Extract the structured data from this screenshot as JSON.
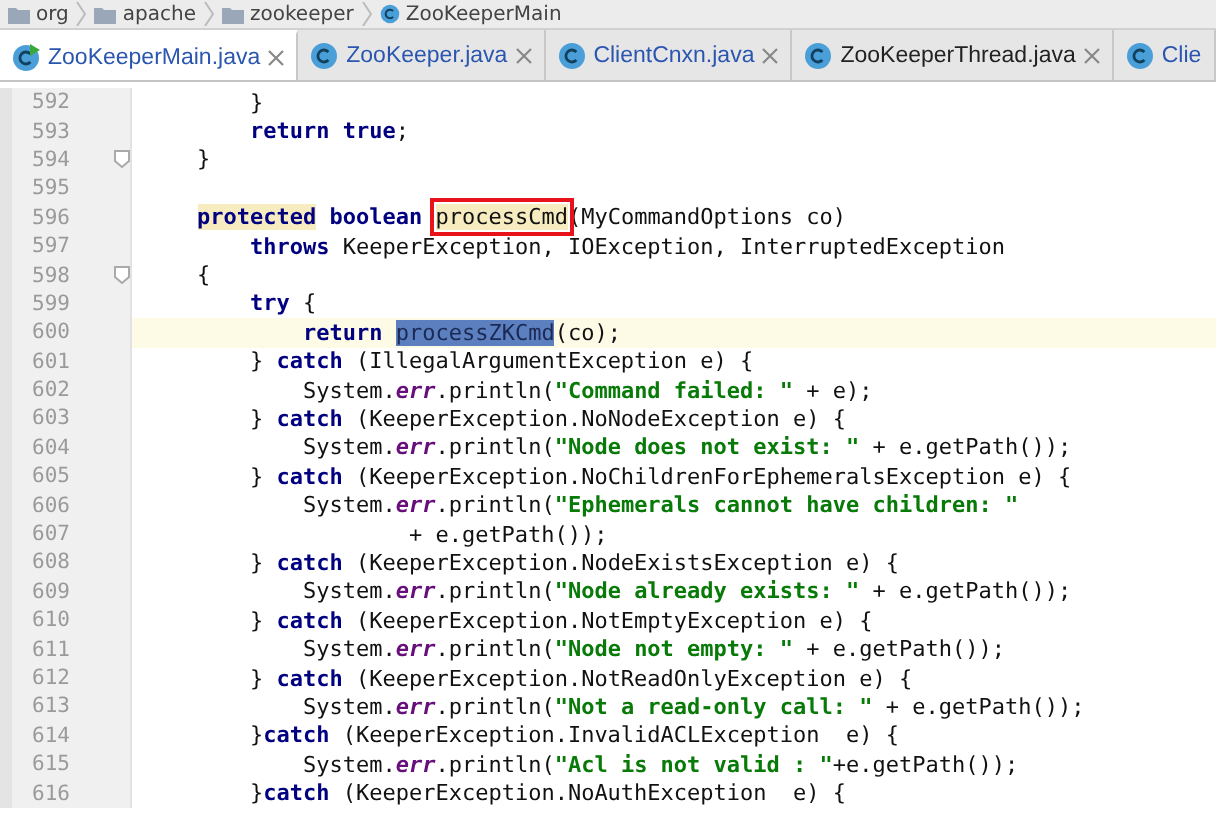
{
  "breadcrumbs": [
    {
      "label": "org",
      "kind": "folder"
    },
    {
      "label": "apache",
      "kind": "folder"
    },
    {
      "label": "zookeeper",
      "kind": "folder"
    },
    {
      "label": "ZooKeeperMain",
      "kind": "class"
    }
  ],
  "tabs": [
    {
      "label": "ZooKeeperMain.java",
      "selected": true,
      "runnable": true,
      "closable": true,
      "color": "#2a56b0"
    },
    {
      "label": "ZooKeeper.java",
      "selected": false,
      "runnable": false,
      "closable": true,
      "color": "#2a56b0"
    },
    {
      "label": "ClientCnxn.java",
      "selected": false,
      "runnable": false,
      "closable": true,
      "color": "#2a56b0"
    },
    {
      "label": "ZooKeeperThread.java",
      "selected": false,
      "runnable": false,
      "closable": true,
      "color": "#222222"
    },
    {
      "label": "Clie",
      "selected": false,
      "runnable": false,
      "closable": false,
      "color": "#2a56b0"
    }
  ],
  "lines": [
    {
      "number": "592",
      "current": false,
      "fold": false,
      "tokens": [
        {
          "text": "        }",
          "kind": "plain"
        }
      ]
    },
    {
      "number": "593",
      "current": false,
      "fold": false,
      "tokens": [
        {
          "text": "        return",
          "kind": "keyword"
        },
        {
          "text": " true",
          "kind": "keyword"
        },
        {
          "text": ";",
          "kind": "plain"
        }
      ]
    },
    {
      "number": "594",
      "current": false,
      "fold": true,
      "tokens": [
        {
          "text": "    }",
          "kind": "plain"
        }
      ]
    },
    {
      "number": "595",
      "current": false,
      "fold": false
    },
    {
      "number": "596",
      "current": false,
      "fold": false,
      "tokens": [
        {
          "text": "    protected",
          "kind": "warning"
        },
        {
          "text": " boolean ",
          "kind": "keyword"
        },
        {
          "text": "processCmd",
          "kind": "boxed"
        },
        {
          "text": "(MyCommandOptions co)",
          "kind": "plain"
        }
      ]
    },
    {
      "number": "597",
      "current": false,
      "fold": false,
      "tokens": [
        {
          "text": "        throws",
          "kind": "keyword"
        },
        {
          "text": " KeeperException, IOException, InterruptedException",
          "kind": "plain"
        }
      ]
    },
    {
      "number": "598",
      "current": false,
      "fold": true,
      "tokens": [
        {
          "text": "    {",
          "kind": "plain"
        }
      ]
    },
    {
      "number": "599",
      "current": false,
      "fold": false,
      "tokens": [
        {
          "text": "        try",
          "kind": "keyword"
        },
        {
          "text": " {",
          "kind": "plain"
        }
      ]
    },
    {
      "number": "600",
      "current": true,
      "fold": false,
      "tokens": [
        {
          "text": "            return ",
          "kind": "keyword"
        },
        {
          "text": "processZKCmd",
          "kind": "selected"
        },
        {
          "text": "(co);",
          "kind": "plain"
        }
      ]
    },
    {
      "number": "601",
      "current": false,
      "fold": false,
      "tokens": [
        {
          "text": "        } ",
          "kind": "plain"
        },
        {
          "text": "catch",
          "kind": "keyword"
        },
        {
          "text": " (IllegalArgumentException e) {",
          "kind": "plain"
        }
      ]
    },
    {
      "number": "602",
      "current": false,
      "fold": false,
      "tokens": [
        {
          "text": "            System.",
          "kind": "plain"
        },
        {
          "text": "err",
          "kind": "field"
        },
        {
          "text": ".println(",
          "kind": "plain"
        },
        {
          "text": "\"Command failed: \"",
          "kind": "string"
        },
        {
          "text": " + e);",
          "kind": "plain"
        }
      ]
    },
    {
      "number": "603",
      "current": false,
      "fold": false,
      "tokens": [
        {
          "text": "        } ",
          "kind": "plain"
        },
        {
          "text": "catch",
          "kind": "keyword"
        },
        {
          "text": " (KeeperException.NoNodeException e) {",
          "kind": "plain"
        }
      ]
    },
    {
      "number": "604",
      "current": false,
      "fold": false,
      "tokens": [
        {
          "text": "            System.",
          "kind": "plain"
        },
        {
          "text": "err",
          "kind": "field"
        },
        {
          "text": ".println(",
          "kind": "plain"
        },
        {
          "text": "\"Node does not exist: \"",
          "kind": "string"
        },
        {
          "text": " + e.getPath());",
          "kind": "plain"
        }
      ]
    },
    {
      "number": "605",
      "current": false,
      "fold": false,
      "tokens": [
        {
          "text": "        } ",
          "kind": "plain"
        },
        {
          "text": "catch",
          "kind": "keyword"
        },
        {
          "text": " (KeeperException.NoChildrenForEphemeralsException e) {",
          "kind": "plain"
        }
      ]
    },
    {
      "number": "606",
      "current": false,
      "fold": false,
      "tokens": [
        {
          "text": "            System.",
          "kind": "plain"
        },
        {
          "text": "err",
          "kind": "field"
        },
        {
          "text": ".println(",
          "kind": "plain"
        },
        {
          "text": "\"Ephemerals cannot have children: \"",
          "kind": "string"
        }
      ]
    },
    {
      "number": "607",
      "current": false,
      "fold": false,
      "tokens": [
        {
          "text": "                    + e.getPath());",
          "kind": "plain"
        }
      ]
    },
    {
      "number": "608",
      "current": false,
      "fold": false,
      "tokens": [
        {
          "text": "        } ",
          "kind": "plain"
        },
        {
          "text": "catch",
          "kind": "keyword"
        },
        {
          "text": " (KeeperException.NodeExistsException e) {",
          "kind": "plain"
        }
      ]
    },
    {
      "number": "609",
      "current": false,
      "fold": false,
      "tokens": [
        {
          "text": "            System.",
          "kind": "plain"
        },
        {
          "text": "err",
          "kind": "field"
        },
        {
          "text": ".println(",
          "kind": "plain"
        },
        {
          "text": "\"Node already exists: \"",
          "kind": "string"
        },
        {
          "text": " + e.getPath());",
          "kind": "plain"
        }
      ]
    },
    {
      "number": "610",
      "current": false,
      "fold": false,
      "tokens": [
        {
          "text": "        } ",
          "kind": "plain"
        },
        {
          "text": "catch",
          "kind": "keyword"
        },
        {
          "text": " (KeeperException.NotEmptyException e) {",
          "kind": "plain"
        }
      ]
    },
    {
      "number": "611",
      "current": false,
      "fold": false,
      "tokens": [
        {
          "text": "            System.",
          "kind": "plain"
        },
        {
          "text": "err",
          "kind": "field"
        },
        {
          "text": ".println(",
          "kind": "plain"
        },
        {
          "text": "\"Node not empty: \"",
          "kind": "string"
        },
        {
          "text": " + e.getPath());",
          "kind": "plain"
        }
      ]
    },
    {
      "number": "612",
      "current": false,
      "fold": false,
      "tokens": [
        {
          "text": "        } ",
          "kind": "plain"
        },
        {
          "text": "catch",
          "kind": "keyword"
        },
        {
          "text": " (KeeperException.NotReadOnlyException e) {",
          "kind": "plain"
        }
      ]
    },
    {
      "number": "613",
      "current": false,
      "fold": false,
      "tokens": [
        {
          "text": "            System.",
          "kind": "plain"
        },
        {
          "text": "err",
          "kind": "field"
        },
        {
          "text": ".println(",
          "kind": "plain"
        },
        {
          "text": "\"Not a read-only call: \"",
          "kind": "string"
        },
        {
          "text": " + e.getPath());",
          "kind": "plain"
        }
      ]
    },
    {
      "number": "614",
      "current": false,
      "fold": false,
      "tokens": [
        {
          "text": "        }",
          "kind": "plain"
        },
        {
          "text": "catch",
          "kind": "keyword"
        },
        {
          "text": " (KeeperException.InvalidACLException  e) {",
          "kind": "plain"
        }
      ]
    },
    {
      "number": "615",
      "current": false,
      "fold": false,
      "tokens": [
        {
          "text": "            System.",
          "kind": "plain"
        },
        {
          "text": "err",
          "kind": "field"
        },
        {
          "text": ".println(",
          "kind": "plain"
        },
        {
          "text": "\"Acl is not valid : \"",
          "kind": "string"
        },
        {
          "text": "+e.getPath());",
          "kind": "plain"
        }
      ]
    },
    {
      "number": "616",
      "current": false,
      "fold": false,
      "tokens": [
        {
          "text": "        }",
          "kind": "plain"
        },
        {
          "text": "catch",
          "kind": "keyword"
        },
        {
          "text": " (KeeperException.NoAuthException  e) {",
          "kind": "plain"
        }
      ]
    }
  ]
}
